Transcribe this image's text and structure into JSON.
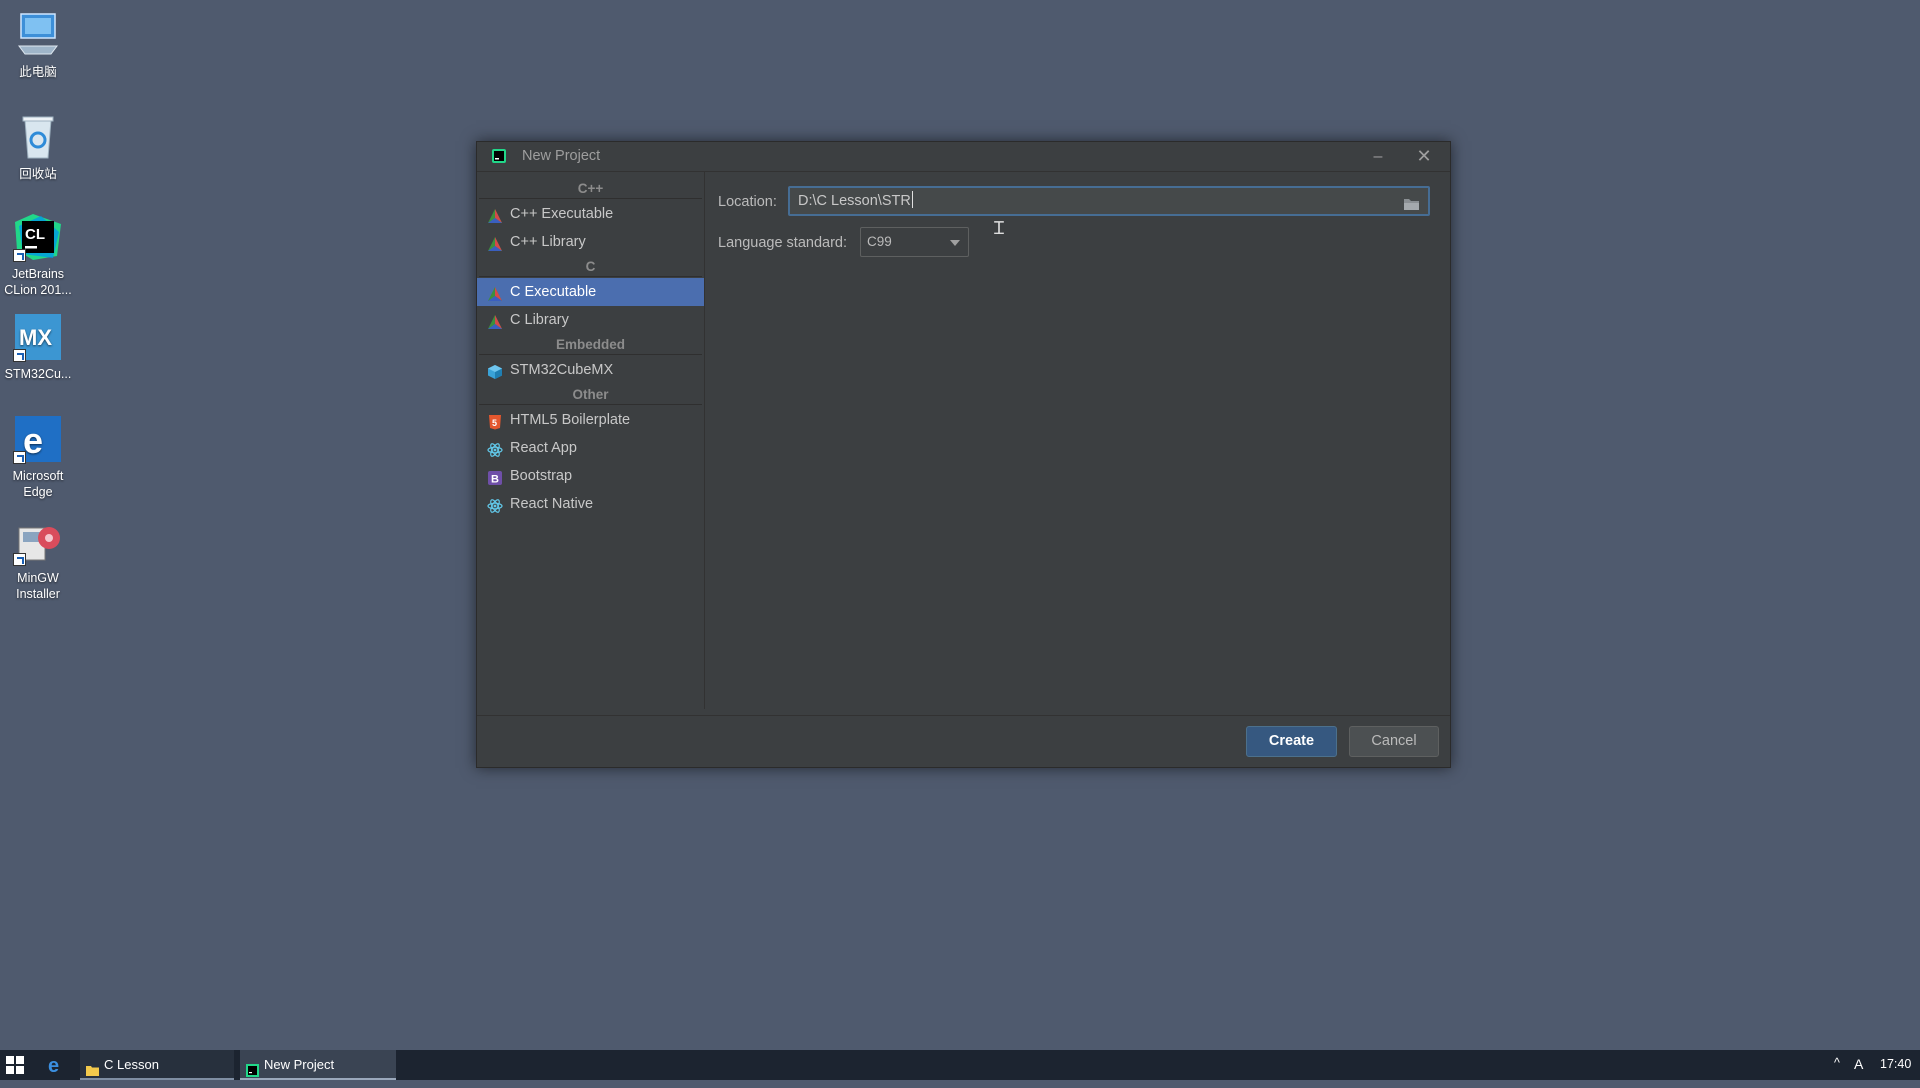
{
  "desktop": {
    "icons": [
      {
        "label": "此电脑"
      },
      {
        "label": "回收站"
      },
      {
        "label": "JetBrains\nCLion 201..."
      },
      {
        "label": "STM32Cu..."
      },
      {
        "label": "Microsoft\nEdge"
      },
      {
        "label": "MinGW\nInstaller"
      }
    ]
  },
  "dialog": {
    "title": "New Project",
    "minimize": "–",
    "close": "✕",
    "sidebar": {
      "groups": {
        "cpp": "C++",
        "c": "C",
        "embedded": "Embedded",
        "other": "Other"
      },
      "items": {
        "cpp_exe": "C++ Executable",
        "cpp_lib": "C++ Library",
        "c_exe": "C Executable",
        "c_lib": "C Library",
        "stm32": "STM32CubeMX",
        "html5": "HTML5 Boilerplate",
        "react_app": "React App",
        "bootstrap": "Bootstrap",
        "react_native": "React Native"
      },
      "selected": "C Executable"
    },
    "form": {
      "location_label": "Location:",
      "location_value": "D:\\C Lesson\\STR",
      "language_label": "Language standard:",
      "language_value": "C99"
    },
    "buttons": {
      "create": "Create",
      "cancel": "Cancel"
    }
  },
  "taskbar": {
    "tasks": [
      {
        "label": "C Lesson"
      },
      {
        "label": "New Project"
      }
    ],
    "clock": "17:40",
    "ime": "A",
    "tray_arrow": "^"
  },
  "colors": {
    "desktop": "#4f5a6e",
    "dialog_bg": "#3c3f41",
    "selection": "#4b6eaf",
    "create_button": "#365880",
    "focus_border": "#466d94"
  }
}
